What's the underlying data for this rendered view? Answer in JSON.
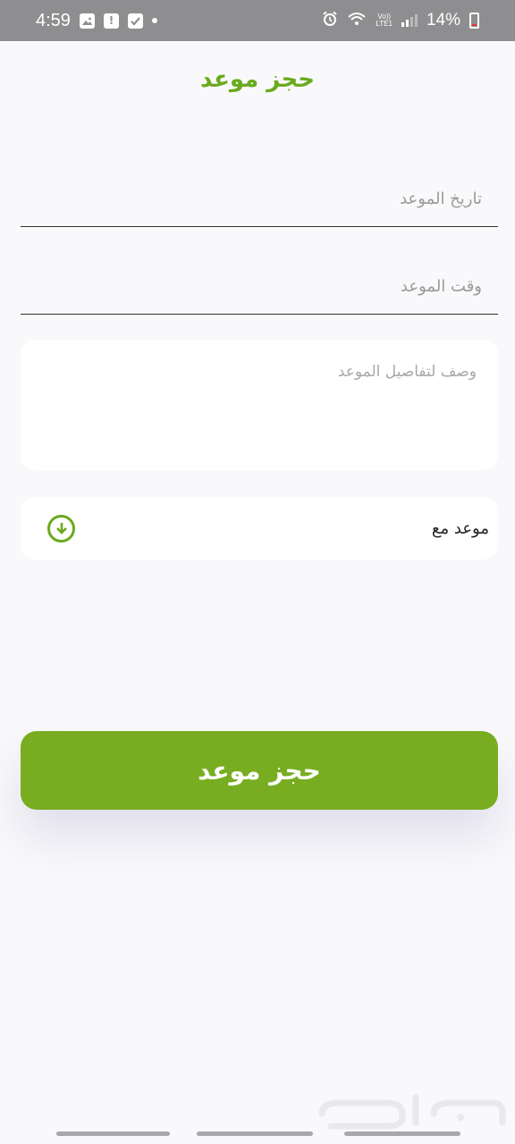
{
  "status_bar": {
    "time": "4:59",
    "battery_text": "14%",
    "volte_top": "Vo))",
    "volte_bottom": "LTE1",
    "battery_level": 0.14,
    "icons": [
      "gallery-icon",
      "alert-icon",
      "check-icon",
      "dot-icon",
      "alarm-icon",
      "wifi-icon",
      "volte-icon",
      "signal-icon",
      "battery-icon"
    ]
  },
  "page": {
    "title": "حجز موعد"
  },
  "form": {
    "date_placeholder": "تاريخ الموعد",
    "time_placeholder": "وقت الموعد",
    "description_placeholder": "وصف لتفاصيل الموعد",
    "appointment_with_label": "موعد مع",
    "appointment_with_icon": "download-circle-icon",
    "submit_label": "حجز موعد"
  },
  "colors": {
    "accent": "#6aaa1e",
    "button": "#78ad21",
    "status_bar": "#8e8e90",
    "background": "#f9f9fb"
  },
  "watermark": {
    "name": "haraj-watermark-logo",
    "text": "حراج"
  }
}
